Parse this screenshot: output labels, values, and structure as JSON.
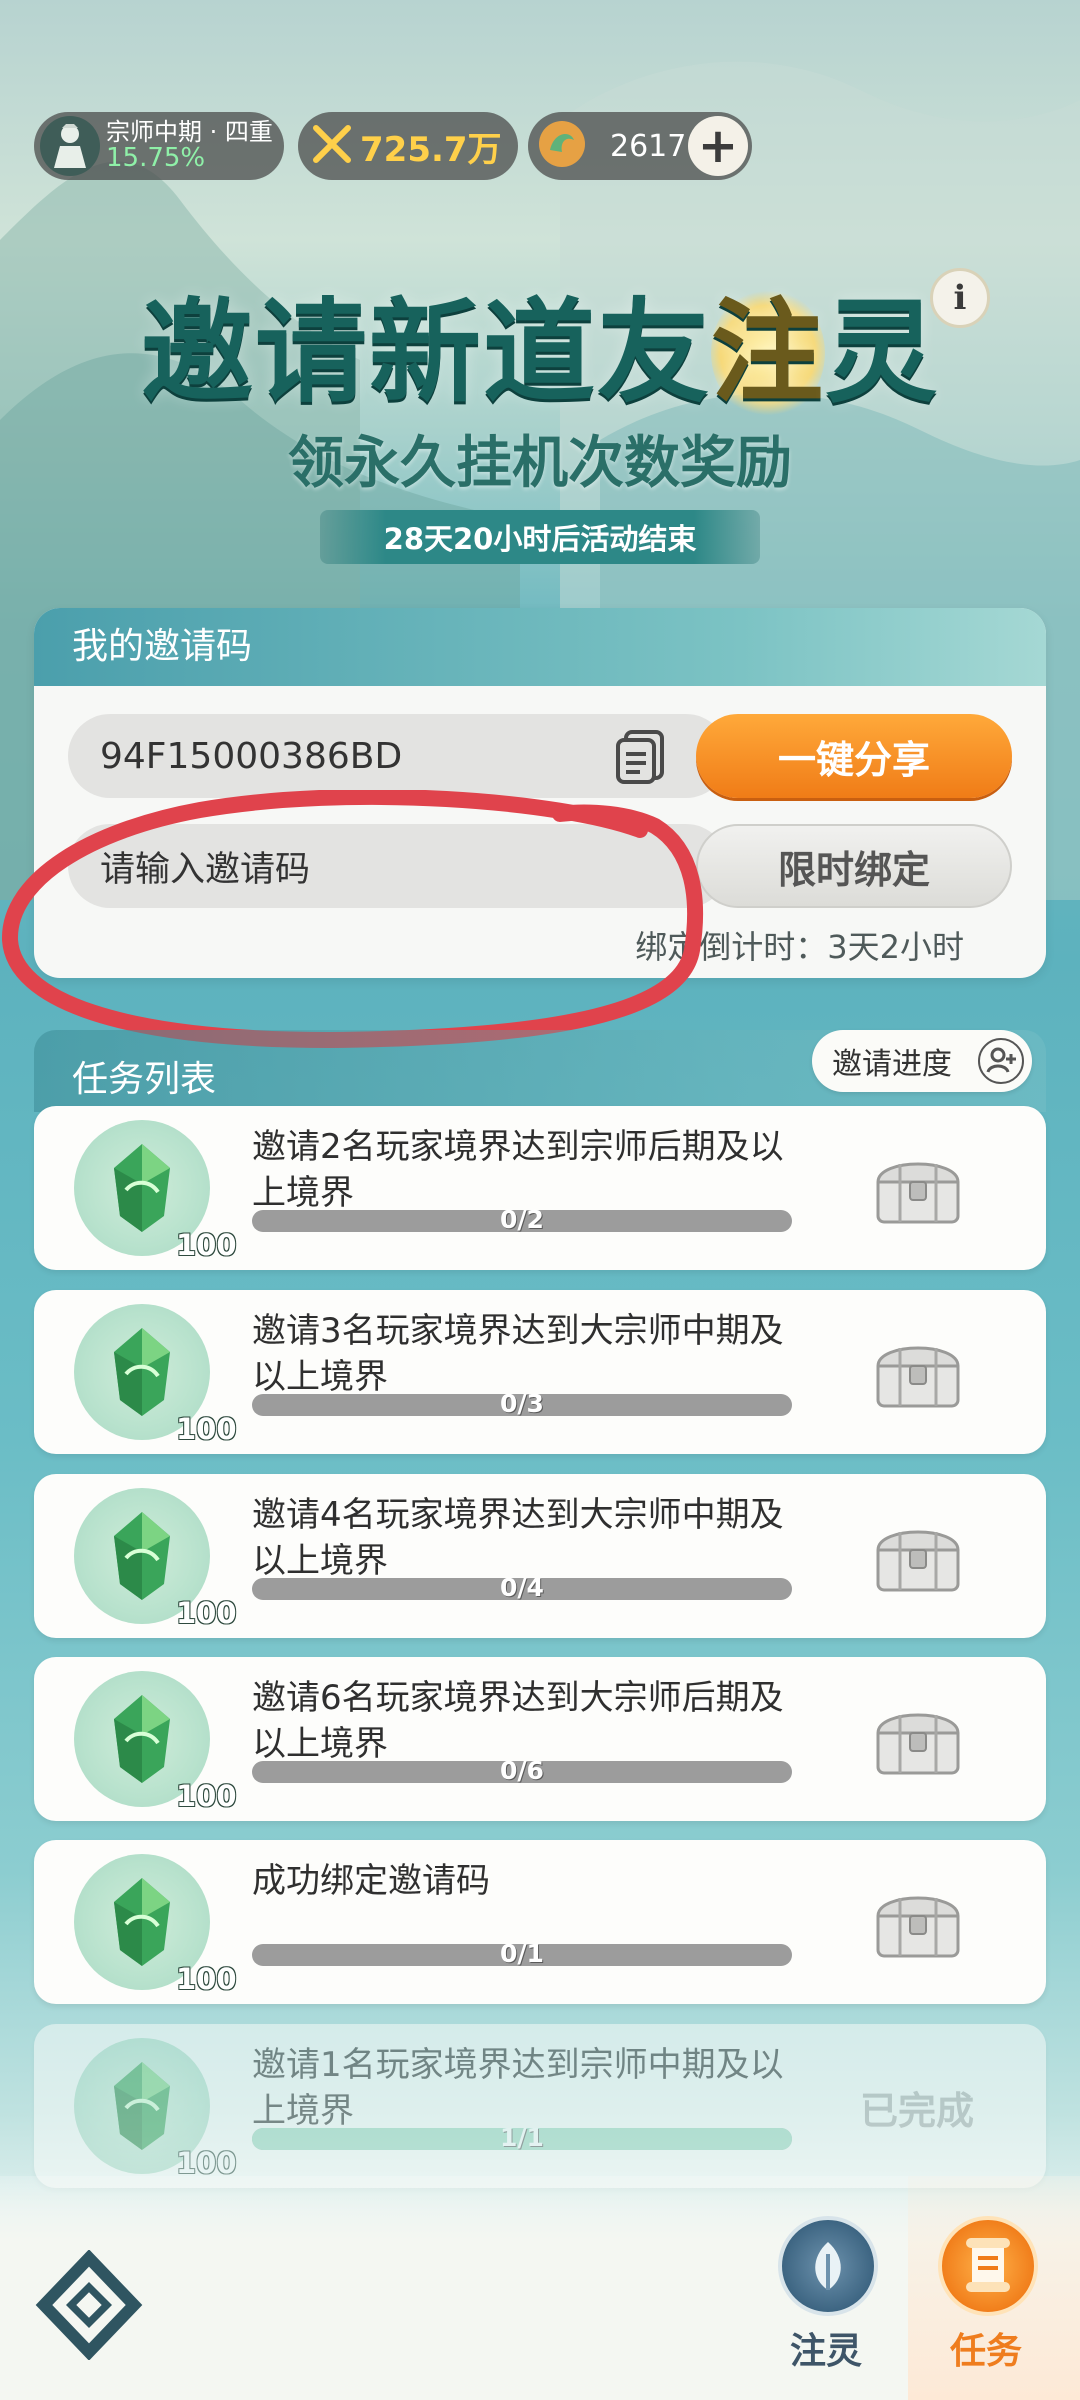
{
  "status": {
    "realm_name": "宗师中期 · 四重",
    "realm_progress": "15.75%",
    "combat_power": "725.7万",
    "currency": "2617",
    "add_label": "+"
  },
  "header": {
    "info_label": "i",
    "title_prefix": "邀请新道友",
    "title_highlight": "注",
    "title_suffix": "灵",
    "subtitle": "领永久挂机次数奖励",
    "countdown": "28天20小时后活动结束"
  },
  "invite": {
    "heading": "我的邀请码",
    "code": "94F15000386BD",
    "share_label": "一键分享",
    "input_placeholder": "请输入邀请码",
    "bind_label": "限时绑定",
    "bind_countdown": "绑定倒计时：3天2小时"
  },
  "tasks": {
    "heading": "任务列表",
    "progress_label": "邀请进度",
    "items": [
      {
        "desc": "邀请2名玩家境界达到宗师后期及以上境界",
        "reward": "100",
        "progress": "0/2",
        "fraction": 0
      },
      {
        "desc": "邀请3名玩家境界达到大宗师中期及以上境界",
        "reward": "100",
        "progress": "0/3",
        "fraction": 0
      },
      {
        "desc": "邀请4名玩家境界达到大宗师中期及以上境界",
        "reward": "100",
        "progress": "0/4",
        "fraction": 0
      },
      {
        "desc": "邀请6名玩家境界达到大宗师后期及以上境界",
        "reward": "100",
        "progress": "0/6",
        "fraction": 0
      },
      {
        "desc": "成功绑定邀请码",
        "reward": "100",
        "progress": "0/1",
        "fraction": 0
      },
      {
        "desc": "邀请1名玩家境界达到宗师中期及以上境界",
        "reward": "100",
        "progress": "1/1",
        "fraction": 1,
        "status": "已完成"
      }
    ]
  },
  "nav": {
    "zhuling": "注灵",
    "task": "任务"
  },
  "colors": {
    "accent_orange": "#f07c17",
    "title_teal": "#17625c",
    "annotation_red": "#e0434c"
  }
}
